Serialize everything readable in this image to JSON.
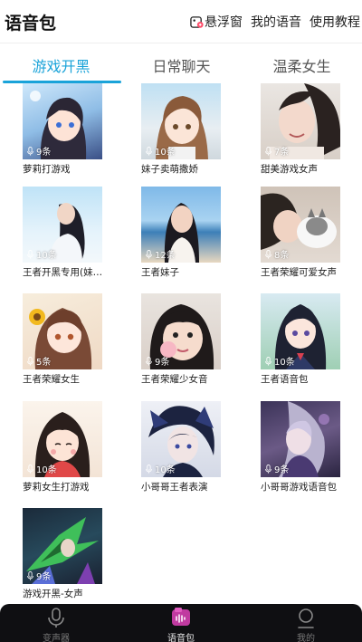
{
  "header": {
    "title": "语音包",
    "actions": [
      {
        "label": "悬浮窗",
        "icon": "floating-window-icon"
      },
      {
        "label": "我的语音"
      },
      {
        "label": "使用教程"
      }
    ]
  },
  "tabs": [
    {
      "label": "游戏开黑",
      "active": true
    },
    {
      "label": "日常聊天",
      "active": false
    },
    {
      "label": "温柔女生",
      "active": false
    }
  ],
  "cards": [
    {
      "name": "萝莉打游戏",
      "count": "9条"
    },
    {
      "name": "妹子卖萌撒娇",
      "count": "10条"
    },
    {
      "name": "甜美游戏女声",
      "count": "7条"
    },
    {
      "name": "王者开黑专用(妹子)",
      "count": "10条"
    },
    {
      "name": "王者妹子",
      "count": "12条"
    },
    {
      "name": "王者荣耀可爱女声",
      "count": "8条"
    },
    {
      "name": "王者荣耀女生",
      "count": "5条"
    },
    {
      "name": "王者荣耀少女音",
      "count": "9条"
    },
    {
      "name": "王者语音包",
      "count": "10条"
    },
    {
      "name": "萝莉女生打游戏",
      "count": "10条"
    },
    {
      "name": "小哥哥王者表演",
      "count": "10条"
    },
    {
      "name": "小哥哥游戏语音包",
      "count": "9条"
    },
    {
      "name": "游戏开黑-女声",
      "count": "9条"
    }
  ],
  "tabbar": [
    {
      "label": "变声器",
      "icon": "microphone-icon",
      "active": false
    },
    {
      "label": "语音包",
      "icon": "voice-pack-icon",
      "active": true
    },
    {
      "label": "我的",
      "icon": "profile-icon",
      "active": false
    }
  ],
  "colors": {
    "accent": "#1aa3d9",
    "tabbar_bg": "#0f0f12",
    "voice_pack_icon": "#c03aa0"
  }
}
